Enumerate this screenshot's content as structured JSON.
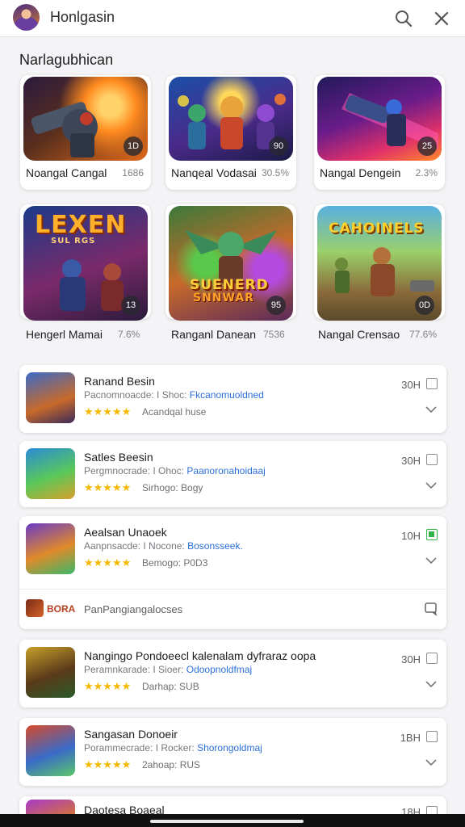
{
  "header": {
    "title": "Honlgasin",
    "search_icon": "search-icon",
    "close_icon": "close-icon"
  },
  "section": {
    "title": "Narlagubhican"
  },
  "featured": [
    {
      "name": "Noangal Cangal",
      "percent": "1686",
      "badge": "1D"
    },
    {
      "name": "Nanqeal Vodasai",
      "percent": "30.5%",
      "badge": "90"
    },
    {
      "name": "Nangal Dengein",
      "percent": "2.3%",
      "badge": "25"
    },
    {
      "name": "Hengerl Mamai",
      "percent": "7.6%",
      "badge": "13",
      "art_text": "LEXEN",
      "art_sub": "SUL  RGS"
    },
    {
      "name": "Ranganl Danean",
      "percent": "7536",
      "badge": "95",
      "art_text": "SUENERD",
      "art_sub": "SNNWAR"
    },
    {
      "name": "Nangal Crensao",
      "percent": "77.6%",
      "badge": "0D",
      "art_text": "CAHOINELS"
    }
  ],
  "list": [
    {
      "title": "Ranand Besin",
      "sub_label": "Pacnomnoacde: I Shoc:",
      "sub_link": "Fkcanomuoldned",
      "stars": "★★★★★",
      "meta": "Acandqal huse",
      "time": "30H",
      "checked": false
    },
    {
      "title": "Satles Beesin",
      "sub_label": "Pergmnocrade: I Ohoc:",
      "sub_link": "Paanorona​hoidaaj",
      "stars": "★★★★★",
      "meta": "Sirhogo: Bogy",
      "time": "30H",
      "checked": false
    },
    {
      "title": "Aealsan Unaoek",
      "sub_label": "Aanpnsacde: I Nocone:",
      "sub_link": "Bosonsseek.",
      "stars": "★★★★★",
      "meta": "Bemogo: P0D3",
      "time": "10H",
      "checked": true
    },
    {
      "title": "Nangingo Pondoeecl kalenalam dyfraraz oopa",
      "sub_label": "Peramnkarade: I Sioer:",
      "sub_link": "Odoopnoldfmaj",
      "stars": "★★★★★",
      "meta": "Darhap: SUB",
      "time": "30H",
      "checked": false
    },
    {
      "title": "Sangasan Donoeir",
      "sub_label": "Porammecrade: I Rocker:",
      "sub_link": "Shorongoldmaj",
      "stars": "★★★★★",
      "meta": "2ahoap: RUS",
      "time": "1BH",
      "checked": false
    },
    {
      "title": "Daotesa Boaeal",
      "time": "18H"
    }
  ],
  "subrow": {
    "tag": "BORA",
    "text": "PanPangiangalocses"
  }
}
